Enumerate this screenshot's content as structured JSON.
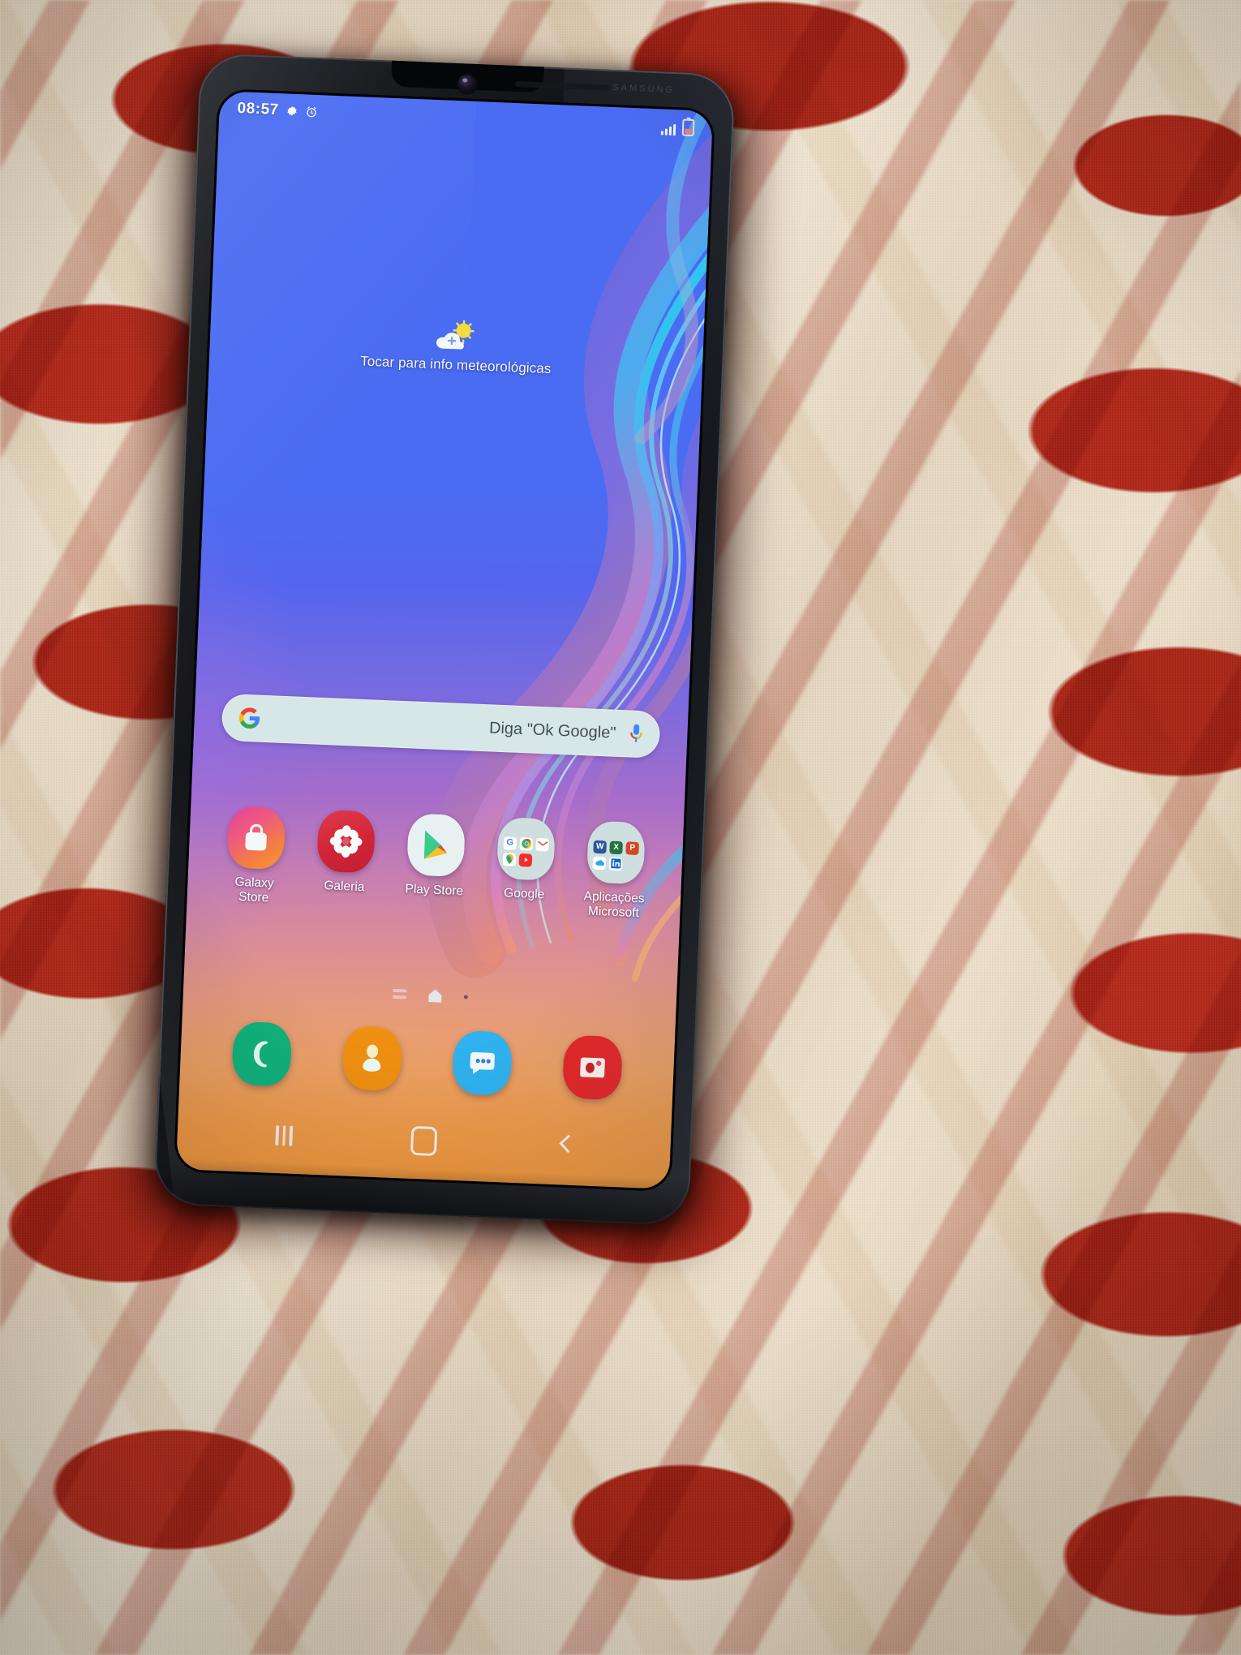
{
  "device": {
    "brand_text": "SAMSUNG",
    "scene": "Samsung Galaxy smartphone lying on red and cream velvet fabric"
  },
  "status_bar": {
    "time": "08:57",
    "left_icons": [
      {
        "name": "gear-icon",
        "glyph": "✻"
      },
      {
        "name": "alarm-icon",
        "glyph": "◎"
      }
    ],
    "signal_bars": 4,
    "battery_level_percent": 30
  },
  "weather_widget": {
    "label": "Tocar para info meteorológicas",
    "icon": "sun-behind-cloud-plus-icon"
  },
  "search": {
    "placeholder": "Diga \"Ok Google\"",
    "logo": "google-g-icon",
    "mic": "microphone-icon"
  },
  "apps": [
    {
      "label": "Galaxy\nStore",
      "label_lines": [
        "Galaxy",
        "Store"
      ],
      "icon": "galaxy-store-icon",
      "color": "#ef5a7e"
    },
    {
      "label": "Galeria",
      "label_lines": [
        "Galeria"
      ],
      "icon": "gallery-icon",
      "color": "#d12437"
    },
    {
      "label": "Play Store",
      "label_lines": [
        "Play Store"
      ],
      "icon": "play-store-icon",
      "color": "#e7f1f2"
    },
    {
      "label": "Google",
      "label_lines": [
        "Google"
      ],
      "icon": "google-folder-icon",
      "color": "#cfdede",
      "folder_items": [
        "google-icon",
        "chrome-icon",
        "gmail-icon",
        "maps-icon",
        "youtube-icon"
      ]
    },
    {
      "label": "Aplicações\nMicrosoft",
      "label_lines": [
        "Aplicações",
        "Microsoft"
      ],
      "icon": "microsoft-folder-icon",
      "color": "#cfdede",
      "folder_items": [
        "word-icon",
        "excel-icon",
        "powerpoint-icon",
        "onedrive-icon",
        "linkedin-icon"
      ]
    }
  ],
  "page_indicator": {
    "items": [
      "app-list-icon",
      "home-page-icon",
      "page-dot"
    ],
    "active_index": 1
  },
  "dock": [
    {
      "label": "Telefone",
      "icon": "phone-icon",
      "color": "#11b37c"
    },
    {
      "label": "Contactos",
      "icon": "contacts-icon",
      "color": "#f09011"
    },
    {
      "label": "Mensagens",
      "icon": "messages-icon",
      "color": "#2fb3f0"
    },
    {
      "label": "Câmara",
      "icon": "camera-icon",
      "color": "#e5262a"
    }
  ],
  "nav_bar": [
    {
      "name": "recents-button",
      "icon": "recents-icon"
    },
    {
      "name": "home-button",
      "icon": "home-icon"
    },
    {
      "name": "back-button",
      "icon": "back-icon"
    }
  ],
  "colors": {
    "wallpaper_top": "#4a6cf2",
    "wallpaper_mid": "#c07ac0",
    "wallpaper_bottom": "#f29a40",
    "search_bar_bg": "#d7e7e7",
    "fabric_red": "#b02718",
    "fabric_cream": "#ebdfc9"
  }
}
